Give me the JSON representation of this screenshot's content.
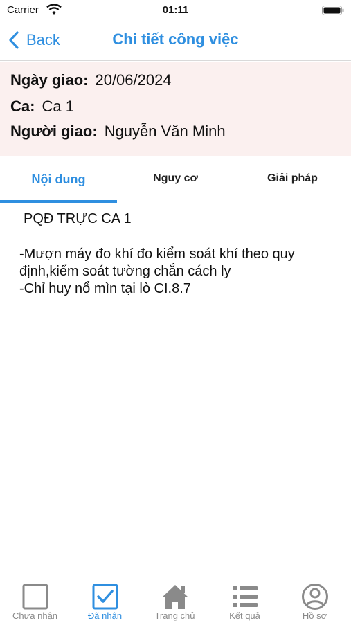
{
  "status_bar": {
    "carrier": "Carrier",
    "time": "01:11"
  },
  "nav": {
    "back_label": "Back",
    "title": "Chi tiết công việc"
  },
  "info": {
    "date_label": "Ngày giao:",
    "date_value": "20/06/2024",
    "shift_label": "Ca:",
    "shift_value": "Ca 1",
    "assigner_label": "Người giao:",
    "assigner_value": "Nguyễn Văn Minh"
  },
  "tabs": [
    {
      "label": "Nội dung",
      "active": true
    },
    {
      "label": "Nguy cơ",
      "active": false
    },
    {
      "label": "Giải pháp",
      "active": false
    }
  ],
  "content": {
    "title": "PQĐ TRỰC CA 1",
    "body": "-Mượn máy đo khí đo kiểm soát khí theo quy định,kiểm soát tường chắn cách ly\n-Chỉ huy nổ mìn tại lò CI.8.7"
  },
  "tab_bar": {
    "items": [
      {
        "label": "Chưa nhận",
        "icon": "checkbox-empty-icon",
        "active": false
      },
      {
        "label": "Đã nhận",
        "icon": "checkbox-checked-icon",
        "active": true
      },
      {
        "label": "Trang chủ",
        "icon": "home-icon",
        "active": false
      },
      {
        "label": "Kết quả",
        "icon": "list-icon",
        "active": false
      },
      {
        "label": "Hồ sơ",
        "icon": "profile-icon",
        "active": false
      }
    ]
  },
  "colors": {
    "accent": "#2f8fe0",
    "info_background": "#fbf0ef",
    "inactive": "#8a8a8a"
  }
}
